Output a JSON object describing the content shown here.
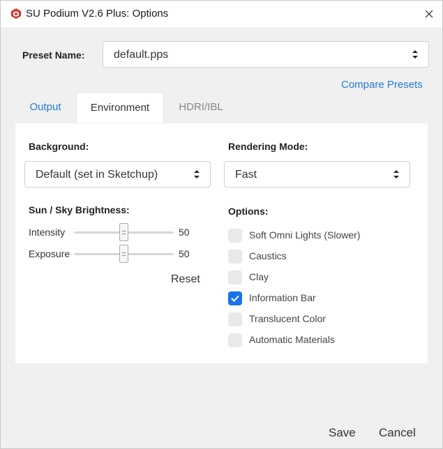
{
  "window": {
    "title": "SU Podium V2.6 Plus: Options"
  },
  "preset": {
    "label": "Preset Name:",
    "value": "default.pps",
    "compare_link": "Compare Presets"
  },
  "tabs": [
    {
      "label": "Output",
      "active": false
    },
    {
      "label": "Environment",
      "active": true
    },
    {
      "label": "HDRI/IBL",
      "active": false
    }
  ],
  "environment": {
    "background_label": "Background:",
    "background_value": "Default (set in Sketchup)",
    "rendering_mode_label": "Rendering Mode:",
    "rendering_mode_value": "Fast",
    "brightness_label": "Sun / Sky Brightness:",
    "sliders": [
      {
        "label": "Intensity",
        "value": "50",
        "fraction": 0.5
      },
      {
        "label": "Exposure",
        "value": "50",
        "fraction": 0.5
      }
    ],
    "reset_label": "Reset",
    "options_label": "Options:",
    "options": [
      {
        "label": "Soft Omni Lights (Slower)",
        "checked": false
      },
      {
        "label": "Caustics",
        "checked": false
      },
      {
        "label": "Clay",
        "checked": false
      },
      {
        "label": "Information Bar",
        "checked": true
      },
      {
        "label": "Translucent Color",
        "checked": false
      },
      {
        "label": "Automatic Materials",
        "checked": false
      }
    ]
  },
  "footer": {
    "save_label": "Save",
    "cancel_label": "Cancel"
  },
  "colors": {
    "accent": "#1a73e8",
    "link": "#1f7bd8",
    "window_bg": "#f0f0f0"
  },
  "icons": {
    "app": "sketchup-icon",
    "close": "close-icon",
    "select_arrows": "sort-arrows-icon",
    "check": "check-icon"
  }
}
